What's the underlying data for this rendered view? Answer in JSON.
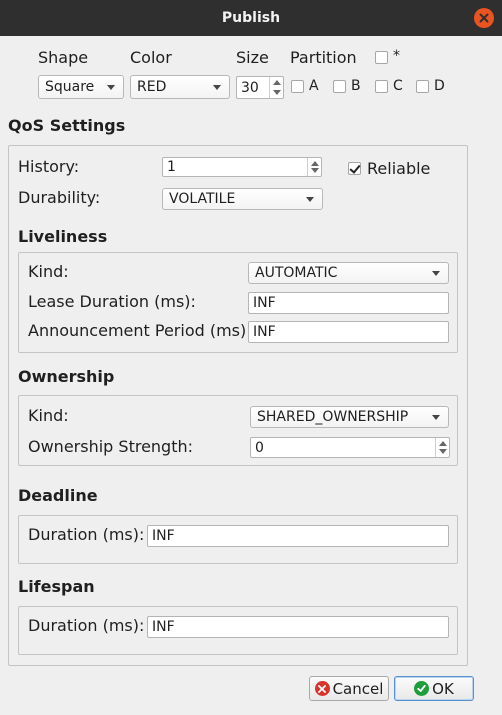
{
  "window": {
    "title": "Publish",
    "close_icon": "close-icon"
  },
  "top": {
    "shape_label": "Shape",
    "color_label": "Color",
    "size_label": "Size",
    "partition_label": "Partition",
    "shape_value": "Square",
    "color_value": "RED",
    "size_value": "30",
    "partition_star_label": "*",
    "partitions": [
      "A",
      "B",
      "C",
      "D"
    ]
  },
  "qos": {
    "title": "QoS Settings",
    "history_label": "History:",
    "history_value": "1",
    "reliable_label": "Reliable",
    "reliable_checked": true,
    "durability_label": "Durability:",
    "durability_value": "VOLATILE"
  },
  "liveliness": {
    "title": "Liveliness",
    "kind_label": "Kind:",
    "kind_value": "AUTOMATIC",
    "lease_label": "Lease Duration (ms):",
    "lease_value": "INF",
    "announce_label": "Announcement Period (ms):",
    "announce_value": "INF"
  },
  "ownership": {
    "title": "Ownership",
    "kind_label": "Kind:",
    "kind_value": "SHARED_OWNERSHIP",
    "strength_label": "Ownership Strength:",
    "strength_value": "0"
  },
  "deadline": {
    "title": "Deadline",
    "duration_label": "Duration (ms):",
    "duration_value": "INF"
  },
  "lifespan": {
    "title": "Lifespan",
    "duration_label": "Duration (ms):",
    "duration_value": "INF"
  },
  "buttons": {
    "cancel_label": "Cancel",
    "ok_label": "OK"
  },
  "colors": {
    "accent_orange": "#e95420",
    "cancel_red": "#d9342b",
    "ok_green": "#1e9e3a",
    "titlebar": "#2f2f2f"
  }
}
